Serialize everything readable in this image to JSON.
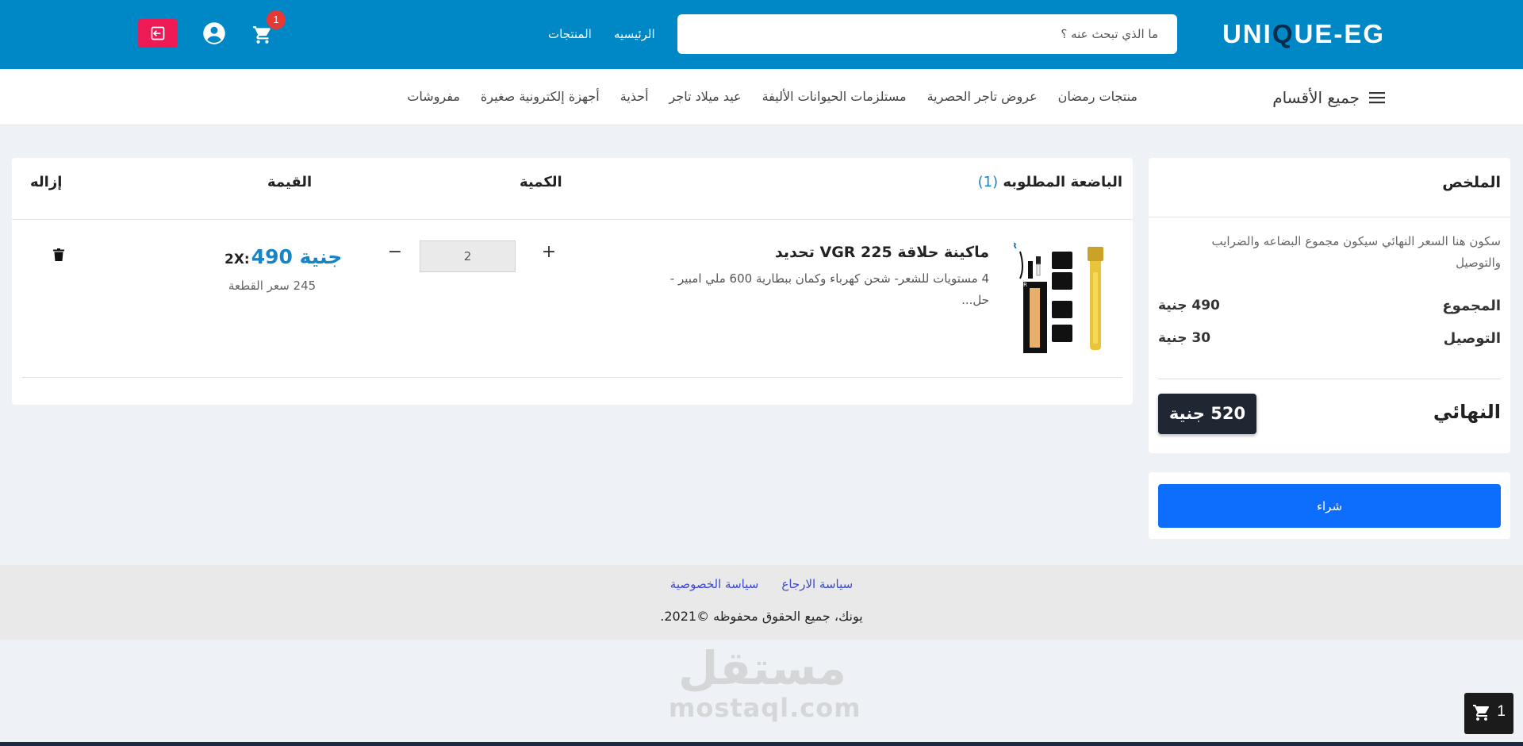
{
  "header": {
    "logo_left": "UNI",
    "logo_q": "Q",
    "logo_right": "UE-EG",
    "search_placeholder": "ما الذي تبحث عنه ؟",
    "nav_home": "الرئيسيه",
    "nav_products": "المنتجات",
    "cart_count": "1",
    "icons": [
      "cart-icon",
      "user-circle-icon",
      "logout-icon"
    ],
    "colors": {
      "bar": "#0087c6",
      "logout": "#ee1a56",
      "badge": "#e53935"
    }
  },
  "categories": {
    "all_label": "جميع الأقسام",
    "items": [
      "منتجات رمضان",
      "عروض تاجر الحصرية",
      "مستلزمات الحيوانات الأليفة",
      "عيد ميلاد تاجر",
      "أحذية",
      "أجهزة إلكترونية صغيرة",
      "مفروشات"
    ]
  },
  "cart": {
    "col_item": "الباضعة المطلوبه",
    "item_count": "(1)",
    "col_qty": "الكمية",
    "col_price": "القيمة",
    "col_remove": "إزاله",
    "item": {
      "name": "ماكينة حلاقة VGR 225 تحديد",
      "desc": "4 مستويات للشعر- شحن كهرباء وكمان ببطارية 600 ملي امبير - حل...",
      "qty": "2",
      "multiplier": "2X:",
      "total": "490 جنية",
      "unit_price": "245 سعر القطعة"
    }
  },
  "summary": {
    "title": "الملخص",
    "desc": "سكون هنا السعر النهائي سيكون مجموع البضاعه والضرايب والتوصيل",
    "subtotal_label": "المجموع",
    "subtotal_value": "490 جنية",
    "shipping_label": "التوصيل",
    "shipping_value": "30 جنية",
    "final_label": "النهائي",
    "final_value": "520 جنية",
    "buy_label": "شراء"
  },
  "footer": {
    "return_policy": "سياسة الارجاع",
    "privacy_policy": "سياسة الخصوصية",
    "copyright": "يونك، جميع الحقوق محفوظه ©2021."
  },
  "watermark": {
    "ar": "مستقل",
    "en": "mostaql.com"
  },
  "floating_cart": {
    "count": "1"
  }
}
